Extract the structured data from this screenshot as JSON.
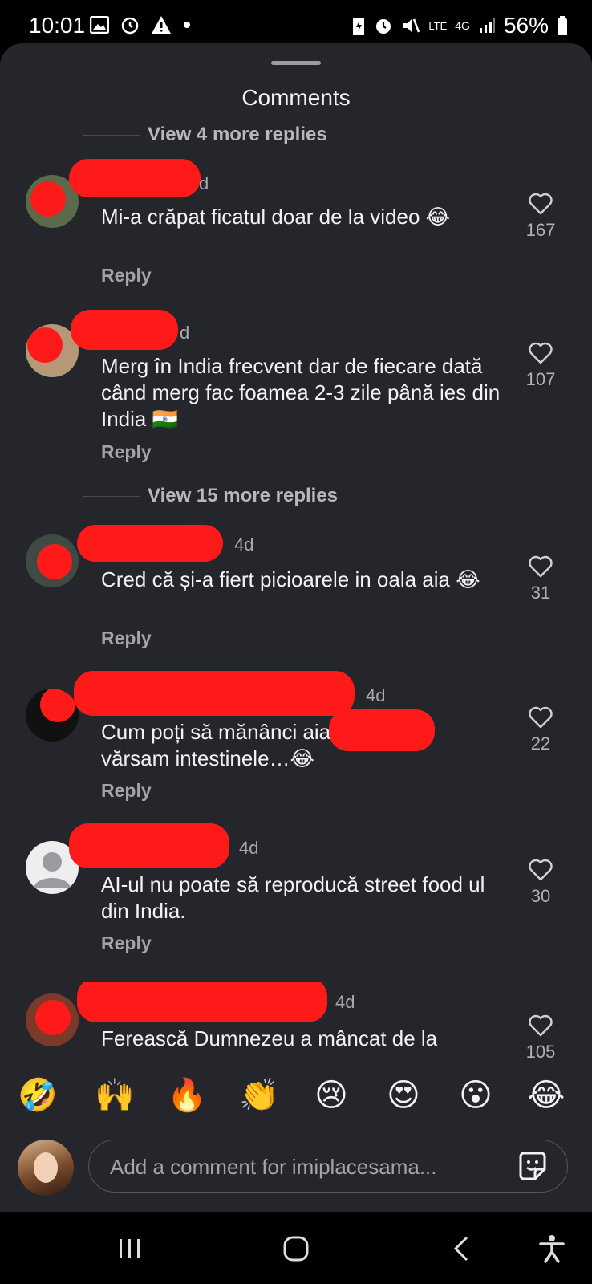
{
  "status_bar": {
    "time": "10:01",
    "battery": "56%",
    "network": "4G",
    "lte": "LTE"
  },
  "sheet": {
    "title": "Comments"
  },
  "view_more": [
    {
      "label": "View 4 more replies"
    },
    {
      "label": "View 15 more replies"
    }
  ],
  "comments": [
    {
      "username": "",
      "time": "d",
      "text": "Mi-a crăpat ficatul doar de la video 😂",
      "reply": "Reply",
      "likes": "167"
    },
    {
      "username": "",
      "time": "d",
      "text": "Merg în India frecvent dar de fiecare dată când merg fac foamea 2-3 zile până ies din India 🇮🇳",
      "reply": "Reply",
      "likes": "107"
    },
    {
      "username": "",
      "time": "4d",
      "text": "Cred că și-a fiert picioarele in oala aia 😂",
      "reply": "Reply",
      "likes": "31"
    },
    {
      "username": "",
      "time": "4d",
      "text": "Cum poți să mănânci                    aia 😂??? Îmi vărsam intestinele…😂",
      "reply": "Reply",
      "likes": "22"
    },
    {
      "username": "",
      "time": "4d",
      "text": "AI-ul nu poate să reproducă street food ul din India.",
      "reply": "Reply",
      "likes": "30"
    },
    {
      "username": "",
      "time": "4d",
      "text": "Ferească Dumnezeu a mâncat de la",
      "reply": "",
      "likes": "105"
    }
  ],
  "emoji_bar": [
    "🤣",
    "🙌",
    "🔥",
    "👏",
    "😢",
    "😍",
    "😮",
    "😂"
  ],
  "composer": {
    "placeholder": "Add a comment for imiplacesama..."
  },
  "nav": {
    "icons": [
      "recent-apps-icon",
      "home-icon",
      "back-icon",
      "accessibility-icon"
    ]
  },
  "colors": {
    "sheet_bg": "#25262b",
    "redaction": "#ff1a1a",
    "heart": "#d0d1d4"
  }
}
